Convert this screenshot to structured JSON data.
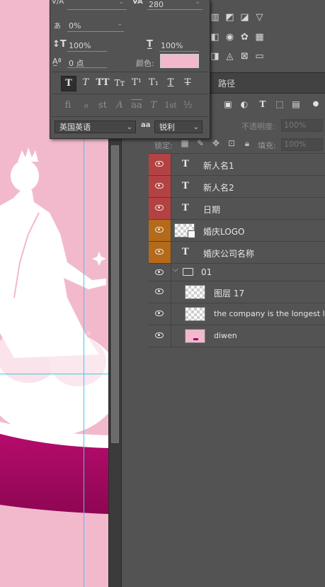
{
  "character_panel": {
    "kerning_label": "V/A",
    "tracking_label": "VA",
    "tracking_value": "280",
    "baseline_shift_percent": "0%",
    "vertical_scale": "100%",
    "horizontal_scale": "100%",
    "baseline_shift": "0 点",
    "color_label": "颜色:",
    "color_swatch": "#f2b9cd",
    "language": "英国英语",
    "aa_label": "aa",
    "antialias": "锐利",
    "style_buttons": [
      "T",
      "T",
      "TT",
      "Tт",
      "T¹",
      "T₁",
      "T",
      "T"
    ],
    "opentype_buttons": [
      "fi",
      "ℴ",
      "st",
      "A",
      "aa",
      "T",
      "1st",
      "½"
    ]
  },
  "tabs": {
    "paths": "路径"
  },
  "layers_panel": {
    "opacity_label": "不透明度:",
    "opacity_value": "100%",
    "lock_label": "锁定:",
    "fill_label": "填充:",
    "fill_value": "100%"
  },
  "layers": [
    {
      "name": "新人名1",
      "kind": "text",
      "color": "red"
    },
    {
      "name": "新人名2",
      "kind": "text",
      "color": "red"
    },
    {
      "name": "日期",
      "kind": "text",
      "color": "red"
    },
    {
      "name": "婚庆LOGO",
      "kind": "smart",
      "color": "orange"
    },
    {
      "name": "婚庆公司名称",
      "kind": "text",
      "color": "orange"
    },
    {
      "name": "01",
      "kind": "group",
      "color": "none"
    },
    {
      "name": "图层 17",
      "kind": "pixel",
      "color": "none"
    },
    {
      "name": "the company is the longest love",
      "kind": "pixel",
      "color": "none"
    },
    {
      "name": "diwen",
      "kind": "pink",
      "color": "none"
    }
  ],
  "colors": {
    "canvas_pink": "#f2b9cd",
    "magenta_base": "#a3075f",
    "red_tag": "#b44243",
    "orange_tag": "#b46a1a",
    "guide": "#46c6e6"
  }
}
